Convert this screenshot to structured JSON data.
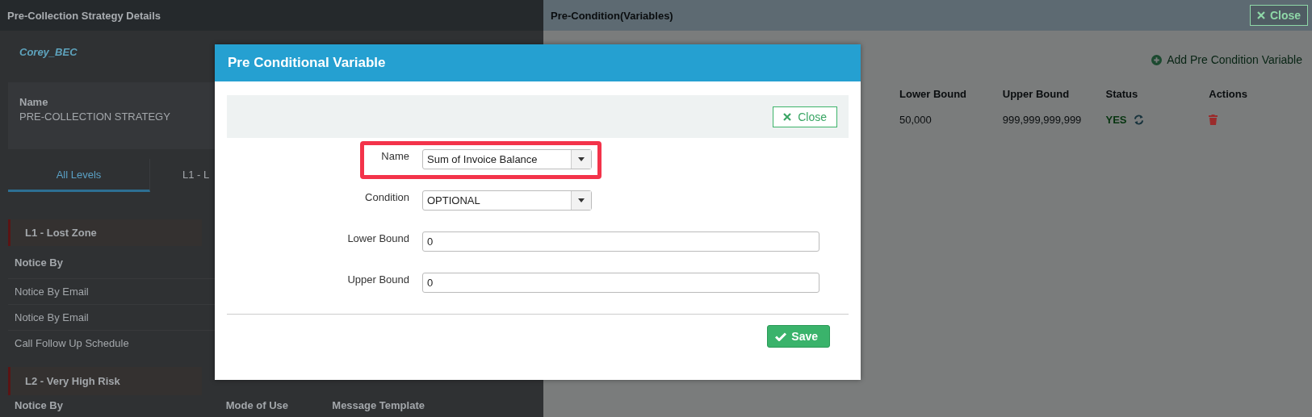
{
  "strategy_panel": {
    "title": "Pre-Collection Strategy Details",
    "owner": "Corey_BEC",
    "name_label": "Name",
    "name_value": "PRE-COLLECTION STRATEGY",
    "tabs": [
      {
        "label": "All Levels",
        "selected": true
      },
      {
        "label": "L1 - L",
        "selected": false
      }
    ],
    "levels": [
      {
        "title": "L1 - Lost Zone",
        "columns": [
          "Notice By"
        ],
        "rows": [
          "Notice By Email",
          "Notice By Email",
          "Call Follow Up Schedule"
        ]
      },
      {
        "title": "L2 - Very High Risk",
        "columns": [
          "Notice By",
          "Mode of Use",
          "Message Template"
        ]
      }
    ]
  },
  "precondition_panel": {
    "title": "Pre-Condition(Variables)",
    "close_label": "Close",
    "add_label": "Add Pre Condition Variable",
    "columns": [
      "Lower Bound",
      "Upper Bound",
      "Status",
      "Actions"
    ],
    "rows": [
      {
        "lower": "50,000",
        "upper": "999,999,999,999",
        "status": "YES"
      }
    ]
  },
  "modal": {
    "title": "Pre Conditional Variable",
    "close_label": "Close",
    "fields": [
      {
        "kind": "select",
        "label": "Name",
        "value": "Sum of Invoice Balance",
        "highlighted": true
      },
      {
        "kind": "select",
        "label": "Condition",
        "value": "OPTIONAL",
        "highlighted": false
      },
      {
        "kind": "text",
        "label": "Lower Bound",
        "value": "0",
        "highlighted": false
      },
      {
        "kind": "text",
        "label": "Upper Bound",
        "value": "0",
        "highlighted": false
      }
    ],
    "save_label": "Save"
  }
}
